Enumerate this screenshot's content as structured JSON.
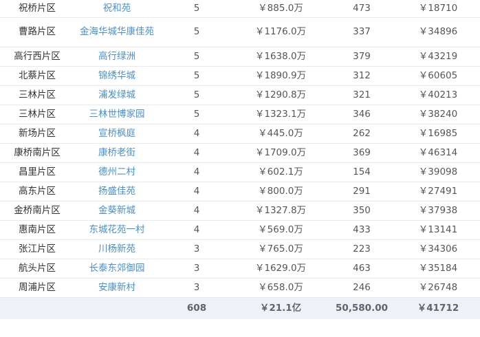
{
  "rows": [
    {
      "district": "祝桥片区",
      "community": "祝和苑",
      "count": "5",
      "price": "￥885.0万",
      "area": "473",
      "unit_price": "￥18710"
    },
    {
      "district": "曹路片区",
      "community": "金海华城华康佳苑",
      "count": "5",
      "price": "￥1176.0万",
      "area": "337",
      "unit_price": "￥34896"
    },
    {
      "district": "高行西片区",
      "community": "高行绿洲",
      "count": "5",
      "price": "￥1638.0万",
      "area": "379",
      "unit_price": "￥43219"
    },
    {
      "district": "北蔡片区",
      "community": "锦绣华城",
      "count": "5",
      "price": "￥1890.9万",
      "area": "312",
      "unit_price": "￥60605"
    },
    {
      "district": "三林片区",
      "community": "浦发绿城",
      "count": "5",
      "price": "￥1290.8万",
      "area": "321",
      "unit_price": "￥40213"
    },
    {
      "district": "三林片区",
      "community": "三林世博家园",
      "count": "5",
      "price": "￥1323.1万",
      "area": "346",
      "unit_price": "￥38240"
    },
    {
      "district": "新场片区",
      "community": "宣桥枫庭",
      "count": "4",
      "price": "￥445.0万",
      "area": "262",
      "unit_price": "￥16985"
    },
    {
      "district": "康桥南片区",
      "community": "康桥老街",
      "count": "4",
      "price": "￥1709.0万",
      "area": "369",
      "unit_price": "￥46314"
    },
    {
      "district": "昌里片区",
      "community": "德州二村",
      "count": "4",
      "price": "￥602.1万",
      "area": "154",
      "unit_price": "￥39098"
    },
    {
      "district": "高东片区",
      "community": "扬盛佳苑",
      "count": "4",
      "price": "￥800.0万",
      "area": "291",
      "unit_price": "￥27491"
    },
    {
      "district": "金桥南片区",
      "community": "金葵新城",
      "count": "4",
      "price": "￥1327.8万",
      "area": "350",
      "unit_price": "￥37938"
    },
    {
      "district": "惠南片区",
      "community": "东城花苑一村",
      "count": "4",
      "price": "￥569.0万",
      "area": "433",
      "unit_price": "￥13141"
    },
    {
      "district": "张江片区",
      "community": "川杨新苑",
      "count": "3",
      "price": "￥765.0万",
      "area": "223",
      "unit_price": "￥34306"
    },
    {
      "district": "航头片区",
      "community": "长泰东郊御园",
      "count": "3",
      "price": "￥1629.0万",
      "area": "463",
      "unit_price": "￥35184"
    },
    {
      "district": "周浦片区",
      "community": "安康新村",
      "count": "3",
      "price": "￥658.0万",
      "area": "246",
      "unit_price": "￥26748"
    }
  ],
  "totals": {
    "district": "",
    "community": "",
    "count": "608",
    "price": "￥21.1亿",
    "area": "50,580.00",
    "unit_price": "￥41712"
  }
}
